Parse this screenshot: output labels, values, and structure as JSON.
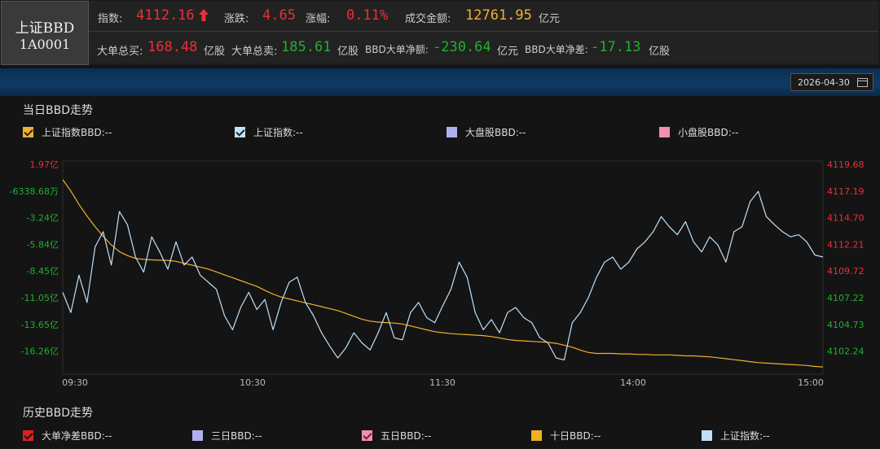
{
  "header": {
    "name": "上证BBD",
    "code": "1A0001",
    "index_label": "指数:",
    "index_value": "4112.16",
    "index_arrow": "up-arrow-icon",
    "change_label": "涨跌:",
    "change_value": "4.65",
    "pct_label": "涨幅:",
    "pct_value": "0.11%",
    "turnover_label": "成交金额:",
    "turnover_value": "12761.95",
    "turnover_unit": "亿元",
    "buy_label": "大单总买:",
    "buy_value": "168.48",
    "buy_unit": "亿股",
    "sell_label": "大单总卖:",
    "sell_value": "185.61",
    "sell_unit": "亿股",
    "netamt_label": "BBD大单净额:",
    "netamt_value": "-230.64",
    "netamt_unit": "亿元",
    "netdiff_label": "BBD大单净差:",
    "netdiff_value": "-17.13",
    "netdiff_unit": "亿股"
  },
  "date_picker": {
    "value": "2026-04-30",
    "icon": "calendar-icon"
  },
  "today_section": {
    "title": "当日BBD走势",
    "legend": [
      {
        "label": "上证指数BBD:--",
        "color": "#f0b030",
        "checked": true
      },
      {
        "label": "上证指数:--",
        "color": "#bfe0f8",
        "checked": true
      },
      {
        "label": "大盘股BBD:--",
        "color": "#b0b0f0",
        "checked": false
      },
      {
        "label": "小盘股BBD:--",
        "color": "#f090b0",
        "checked": false
      }
    ]
  },
  "history_section": {
    "title": "历史BBD走势",
    "legend": [
      {
        "label": "大单净差BBD:--",
        "color": "#e02020",
        "checked": true
      },
      {
        "label": "三日BBD:--",
        "color": "#b0b0f0",
        "checked": false
      },
      {
        "label": "五日BBD:--",
        "color": "#f090b0",
        "checked": true
      },
      {
        "label": "十日BBD:--",
        "color": "#f0b020",
        "checked": false
      },
      {
        "label": "上证指数:--",
        "color": "#bfe0f8",
        "checked": false
      }
    ]
  },
  "chart_data": {
    "type": "line",
    "left_axis_ticks": [
      "1.97亿",
      "-6338.68万",
      "-3.24亿",
      "-5.84亿",
      "-8.45亿",
      "-11.05亿",
      "-13.65亿",
      "-16.26亿"
    ],
    "left_axis_colors": [
      "#e8303a",
      "#20b030",
      "#20b030",
      "#20b030",
      "#20b030",
      "#20b030",
      "#20b030",
      "#20b030"
    ],
    "right_axis_ticks": [
      "4119.68",
      "4117.19",
      "4114.70",
      "4112.21",
      "4109.72",
      "4107.22",
      "4104.73",
      "4102.24"
    ],
    "right_axis_colors": [
      "#e8303a",
      "#e8303a",
      "#e8303a",
      "#e8303a",
      "#e8303a",
      "#20b030",
      "#20b030",
      "#20b030"
    ],
    "x_ticks": [
      "09:30",
      "10:30",
      "11:30",
      "14:00",
      "15:00"
    ],
    "left_range": [
      -18.2,
      3.9
    ],
    "right_range": [
      4100.4,
      4121.5
    ],
    "series": [
      {
        "name": "上证指数BBD",
        "color": "#f0b030",
        "unit": "亿",
        "values": [
          1.97,
          0.8,
          -0.6,
          -1.8,
          -2.9,
          -3.9,
          -4.8,
          -5.5,
          -5.9,
          -6.2,
          -6.3,
          -6.35,
          -6.38,
          -6.4,
          -6.5,
          -6.7,
          -6.9,
          -7.1,
          -7.3,
          -7.6,
          -7.9,
          -8.2,
          -8.5,
          -8.8,
          -9.1,
          -9.5,
          -9.9,
          -10.2,
          -10.4,
          -10.6,
          -10.8,
          -11.0,
          -11.2,
          -11.4,
          -11.6,
          -11.9,
          -12.2,
          -12.5,
          -12.7,
          -12.8,
          -12.85,
          -12.9,
          -13.0,
          -13.2,
          -13.4,
          -13.6,
          -13.8,
          -13.9,
          -14.0,
          -14.05,
          -14.1,
          -14.15,
          -14.2,
          -14.3,
          -14.45,
          -14.6,
          -14.7,
          -14.75,
          -14.8,
          -14.85,
          -14.9,
          -15.0,
          -15.2,
          -15.4,
          -15.7,
          -15.95,
          -16.05,
          -16.05,
          -16.05,
          -16.1,
          -16.1,
          -16.15,
          -16.15,
          -16.2,
          -16.2,
          -16.2,
          -16.25,
          -16.3,
          -16.3,
          -16.35,
          -16.4,
          -16.5,
          -16.6,
          -16.7,
          -16.8,
          -16.9,
          -17.0,
          -17.05,
          -17.1,
          -17.15,
          -17.2,
          -17.25,
          -17.3,
          -17.4,
          -17.45
        ]
      },
      {
        "name": "上证指数",
        "color": "#bfe0f8",
        "unit": "点",
        "values": [
          4108.5,
          4106.5,
          4110.2,
          4107.5,
          4113.0,
          4114.5,
          4111.2,
          4116.5,
          4115.2,
          4112.0,
          4110.5,
          4114.0,
          4112.5,
          4110.8,
          4113.5,
          4111.2,
          4112.0,
          4110.2,
          4109.5,
          4108.8,
          4106.2,
          4104.8,
          4107.0,
          4108.5,
          4106.8,
          4107.8,
          4104.8,
          4107.5,
          4109.5,
          4110.0,
          4107.5,
          4106.2,
          4104.5,
          4103.2,
          4102.0,
          4103.0,
          4104.5,
          4103.5,
          4102.8,
          4104.5,
          4106.5,
          4104.0,
          4103.8,
          4106.5,
          4107.5,
          4106.0,
          4105.5,
          4107.2,
          4108.8,
          4111.5,
          4110.0,
          4106.5,
          4104.8,
          4105.8,
          4104.5,
          4106.5,
          4107.0,
          4106.0,
          4105.5,
          4104.0,
          4103.5,
          4102.0,
          4101.8,
          4105.5,
          4106.5,
          4108.0,
          4110.0,
          4111.5,
          4112.0,
          4110.8,
          4111.5,
          4112.8,
          4113.5,
          4114.5,
          4116.0,
          4115.0,
          4114.2,
          4115.5,
          4113.5,
          4112.5,
          4114.0,
          4113.2,
          4111.5,
          4114.5,
          4115.0,
          4117.5,
          4118.5,
          4116.0,
          4115.2,
          4114.5,
          4114.0,
          4114.2,
          4113.5,
          4112.2,
          4112.0
        ]
      }
    ]
  }
}
